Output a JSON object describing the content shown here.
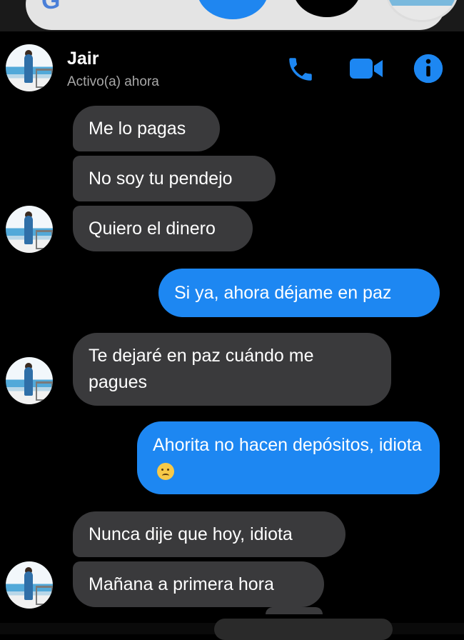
{
  "header": {
    "name": "Jair",
    "status": "Activo(a) ahora",
    "icons": [
      "phone-icon",
      "video-camera-icon",
      "info-icon"
    ]
  },
  "colors": {
    "accent": "#1d87f2",
    "incoming_bubble": "#3a3a3c",
    "background": "#000000",
    "status_text": "#a8a8a8"
  },
  "messages": [
    {
      "from": "contact",
      "text": "Me lo pagas"
    },
    {
      "from": "contact",
      "text": "No soy tu pendejo"
    },
    {
      "from": "contact",
      "text": "Quiero el dinero"
    },
    {
      "from": "me",
      "text": "Si ya, ahora déjame en paz"
    },
    {
      "from": "contact",
      "text": "Te dejaré en paz cuándo me pagues"
    },
    {
      "from": "me",
      "text": "Ahorita no hacen depósitos, idiota",
      "emoji": "worried-face-emoji"
    },
    {
      "from": "contact",
      "text": "Nunca dije que hoy, idiota"
    },
    {
      "from": "contact",
      "text": "Mañana a primera hora"
    }
  ]
}
